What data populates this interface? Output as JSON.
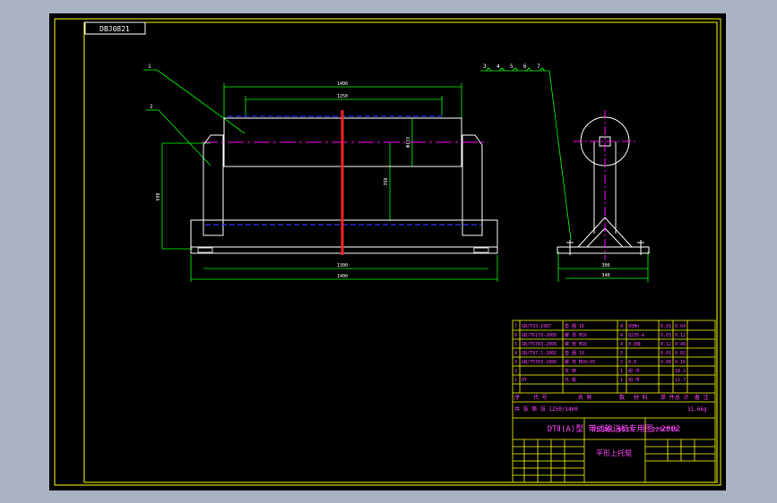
{
  "drawing": {
    "tag_code": "DBJ0821",
    "background_color": "#000000",
    "frame_color": "#ffff00"
  },
  "front_view": {
    "leaders": [
      "1",
      "2"
    ],
    "dims": {
      "top_outer": "1400",
      "top_inner": "1250",
      "roller_dia": "Φ133",
      "height_center": "398",
      "left_height": "590",
      "bottom_inner": "1300",
      "bottom_outer": "1400"
    }
  },
  "side_view": {
    "leaders": [
      "3",
      "4",
      "5",
      "6",
      "7"
    ],
    "dims": {
      "inner": "300",
      "outer": "340"
    }
  },
  "title_block": {
    "parts_rows": [
      [
        "7",
        "GB/T93-1987",
        "垫 圈 16",
        "4",
        "65Mn",
        "0.01",
        "0.04"
      ],
      [
        "6",
        "GB/T6170-2000",
        "螺 母 M16",
        "4",
        "Q235-A",
        "0.03",
        "0.12"
      ],
      [
        "5",
        "GB/T5783-2000",
        "螺 栓 M16",
        "4",
        "8.8级",
        "0.12",
        "0.48"
      ],
      [
        "4",
        "GB/T97.1-2002",
        "垫 圈 16",
        "2",
        "",
        "0.01",
        "0.02"
      ],
      [
        "3",
        "GB/T5783-2000",
        "螺 栓 M16×35",
        "2",
        "8.8",
        "0.08",
        "0.16"
      ],
      [
        "2",
        "",
        "支 架",
        "1",
        "组 件",
        "",
        "18.2"
      ],
      [
        "1",
        "DT",
        "托 辊",
        "1",
        "组 件",
        "",
        "12.7"
      ]
    ],
    "header_row": [
      "序",
      "代 号",
      "名 称",
      "数",
      "材 料",
      "单 件",
      "总 计",
      "备 注"
    ],
    "general_row": "共 张 第 张 1250/1400",
    "total_weight": "31.6kg",
    "series_title": "DTⅡ(A)型  带式输送机专用图－2002",
    "spec_left": "B1200, Φ133",
    "spec_right": "120C510",
    "part_name": "平形上托辊"
  }
}
